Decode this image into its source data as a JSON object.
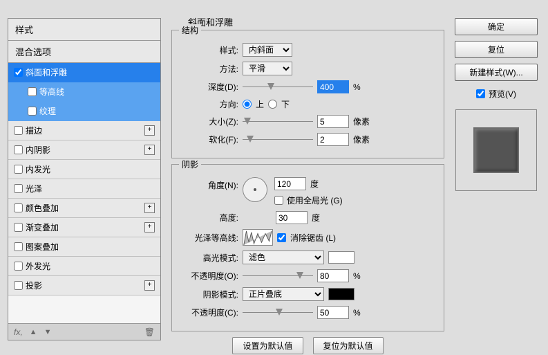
{
  "left": {
    "header": "样式",
    "sub": "混合选项",
    "items": [
      {
        "label": "斜面和浮雕",
        "checked": true,
        "selected": true,
        "plus": false
      },
      {
        "label": "等高线",
        "checked": false,
        "indented": true
      },
      {
        "label": "纹理",
        "checked": false,
        "indented": true
      },
      {
        "label": "描边",
        "checked": false,
        "plus": true
      },
      {
        "label": "内阴影",
        "checked": false,
        "plus": true
      },
      {
        "label": "内发光",
        "checked": false
      },
      {
        "label": "光泽",
        "checked": false
      },
      {
        "label": "颜色叠加",
        "checked": false,
        "plus": true
      },
      {
        "label": "渐变叠加",
        "checked": false,
        "plus": true
      },
      {
        "label": "图案叠加",
        "checked": false
      },
      {
        "label": "外发光",
        "checked": false
      },
      {
        "label": "投影",
        "checked": false,
        "plus": true
      }
    ]
  },
  "title": "斜面和浮雕",
  "struct": {
    "legend": "结构",
    "style_lbl": "样式:",
    "style_val": "内斜面",
    "method_lbl": "方法:",
    "method_val": "平滑",
    "depth_lbl": "深度(D):",
    "depth_val": "400",
    "depth_unit": "%",
    "direction_lbl": "方向:",
    "up": "上",
    "down": "下",
    "size_lbl": "大小(Z):",
    "size_val": "5",
    "size_unit": "像素",
    "soften_lbl": "软化(F):",
    "soften_val": "2",
    "soften_unit": "像素"
  },
  "shading": {
    "legend": "阴影",
    "angle_lbl": "角度(N):",
    "angle_val": "120",
    "deg": "度",
    "global_light": "使用全局光 (G)",
    "altitude_lbl": "高度:",
    "altitude_val": "30",
    "gloss_lbl": "光泽等高线:",
    "antialias": "消除锯齿 (L)",
    "hilite_mode_lbl": "高光模式:",
    "hilite_mode_val": "滤色",
    "hilite_op_lbl": "不透明度(O):",
    "hilite_op_val": "80",
    "shadow_mode_lbl": "阴影模式:",
    "shadow_mode_val": "正片叠底",
    "shadow_op_lbl": "不透明度(C):",
    "shadow_op_val": "50",
    "pct": "%"
  },
  "buttons": {
    "set_default": "设置为默认值",
    "reset_default": "复位为默认值"
  },
  "right": {
    "ok": "确定",
    "cancel": "复位",
    "newstyle": "新建样式(W)...",
    "preview": "预览(V)"
  },
  "fx": "fx,"
}
